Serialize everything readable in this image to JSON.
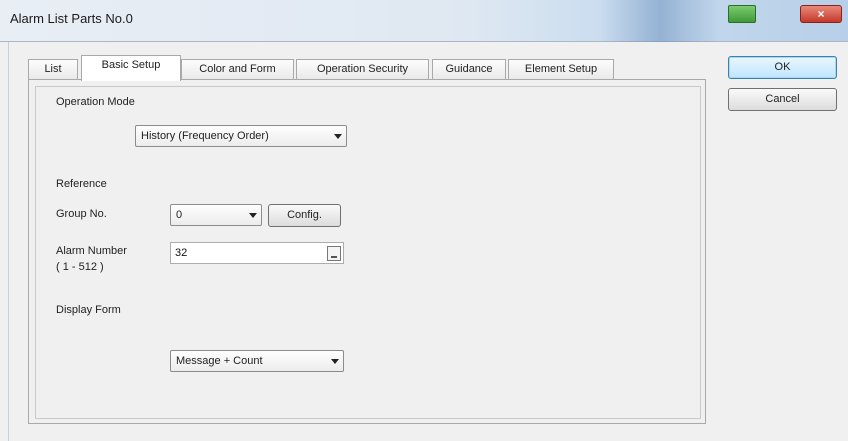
{
  "window": {
    "title": "Alarm List Parts No.0"
  },
  "tabs": [
    "List",
    "Basic Setup",
    "Color and Form",
    "Operation Security",
    "Guidance",
    "Element Setup"
  ],
  "active_tab": "Basic Setup",
  "buttons": {
    "ok": "OK",
    "cancel": "Cancel",
    "config": "Config."
  },
  "basic_setup": {
    "operation_mode_label": "Operation Mode",
    "operation_mode_value": "History (Frequency Order)",
    "reference_label": "Reference",
    "group_no_label": "Group No.",
    "group_no_value": "0",
    "alarm_number_label": "Alarm Number",
    "alarm_number_range": "( 1 - 512 )",
    "alarm_number_value": "32",
    "display_form_label": "Display Form",
    "display_form_value": "Message + Count"
  },
  "icons": {
    "close": "close-icon",
    "minimize": "minimize-icon",
    "keyboard": "keyboard-icon",
    "dropdown": "chevron-down-icon"
  }
}
